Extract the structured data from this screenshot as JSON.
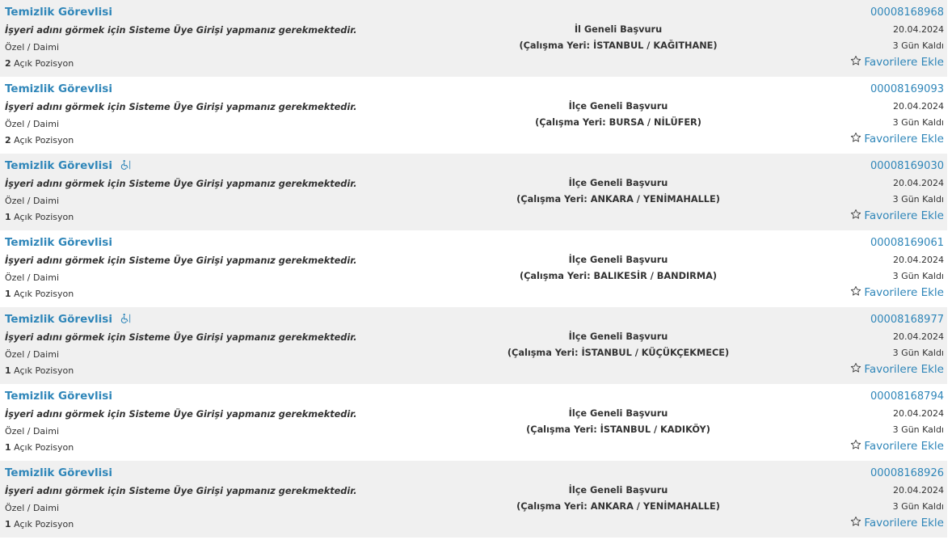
{
  "colors": {
    "link": "#2f86b9",
    "text": "#333333",
    "row_shaded": "#f0f0f0",
    "row_plain": "#ffffff"
  },
  "listings": [
    {
      "title": "Temizlik Görevlisi",
      "disabled_icon": false,
      "notice": "İşyeri adını görmek için Sisteme Üye Girişi yapmanız gerekmektedir.",
      "job_type": "Özel / Daimi",
      "open_count": "2",
      "open_label": "Açık Pozisyon",
      "scope": "İl Geneli Başvuru",
      "location": "(Çalışma Yeri: İSTANBUL / KAĞITHANE)",
      "ad_no": "00008168968",
      "date": "20.04.2024",
      "days_left": "3 Gün Kaldı",
      "favorite_label": "Favorilere Ekle"
    },
    {
      "title": "Temizlik Görevlisi",
      "disabled_icon": false,
      "notice": "İşyeri adını görmek için Sisteme Üye Girişi yapmanız gerekmektedir.",
      "job_type": "Özel / Daimi",
      "open_count": "2",
      "open_label": "Açık Pozisyon",
      "scope": "İlçe Geneli Başvuru",
      "location": "(Çalışma Yeri: BURSA / NİLÜFER)",
      "ad_no": "00008169093",
      "date": "20.04.2024",
      "days_left": "3 Gün Kaldı",
      "favorite_label": "Favorilere Ekle"
    },
    {
      "title": "Temizlik Görevlisi",
      "disabled_icon": true,
      "notice": "İşyeri adını görmek için Sisteme Üye Girişi yapmanız gerekmektedir.",
      "job_type": "Özel / Daimi",
      "open_count": "1",
      "open_label": "Açık Pozisyon",
      "scope": "İlçe Geneli Başvuru",
      "location": "(Çalışma Yeri: ANKARA / YENİMAHALLE)",
      "ad_no": "00008169030",
      "date": "20.04.2024",
      "days_left": "3 Gün Kaldı",
      "favorite_label": "Favorilere Ekle"
    },
    {
      "title": "Temizlik Görevlisi",
      "disabled_icon": false,
      "notice": "İşyeri adını görmek için Sisteme Üye Girişi yapmanız gerekmektedir.",
      "job_type": "Özel / Daimi",
      "open_count": "1",
      "open_label": "Açık Pozisyon",
      "scope": "İlçe Geneli Başvuru",
      "location": "(Çalışma Yeri: BALIKESİR / BANDIRMA)",
      "ad_no": "00008169061",
      "date": "20.04.2024",
      "days_left": "3 Gün Kaldı",
      "favorite_label": "Favorilere Ekle"
    },
    {
      "title": "Temizlik Görevlisi",
      "disabled_icon": true,
      "notice": "İşyeri adını görmek için Sisteme Üye Girişi yapmanız gerekmektedir.",
      "job_type": "Özel / Daimi",
      "open_count": "1",
      "open_label": "Açık Pozisyon",
      "scope": "İlçe Geneli Başvuru",
      "location": "(Çalışma Yeri: İSTANBUL / KÜÇÜKÇEKMECE)",
      "ad_no": "00008168977",
      "date": "20.04.2024",
      "days_left": "3 Gün Kaldı",
      "favorite_label": "Favorilere Ekle"
    },
    {
      "title": "Temizlik Görevlisi",
      "disabled_icon": false,
      "notice": "İşyeri adını görmek için Sisteme Üye Girişi yapmanız gerekmektedir.",
      "job_type": "Özel / Daimi",
      "open_count": "1",
      "open_label": "Açık Pozisyon",
      "scope": "İlçe Geneli Başvuru",
      "location": "(Çalışma Yeri: İSTANBUL / KADIKÖY)",
      "ad_no": "00008168794",
      "date": "20.04.2024",
      "days_left": "3 Gün Kaldı",
      "favorite_label": "Favorilere Ekle"
    },
    {
      "title": "Temizlik Görevlisi",
      "disabled_icon": false,
      "notice": "İşyeri adını görmek için Sisteme Üye Girişi yapmanız gerekmektedir.",
      "job_type": "Özel / Daimi",
      "open_count": "1",
      "open_label": "Açık Pozisyon",
      "scope": "İlçe Geneli Başvuru",
      "location": "(Çalışma Yeri: ANKARA / YENİMAHALLE)",
      "ad_no": "00008168926",
      "date": "20.04.2024",
      "days_left": "3 Gün Kaldı",
      "favorite_label": "Favorilere Ekle"
    }
  ]
}
